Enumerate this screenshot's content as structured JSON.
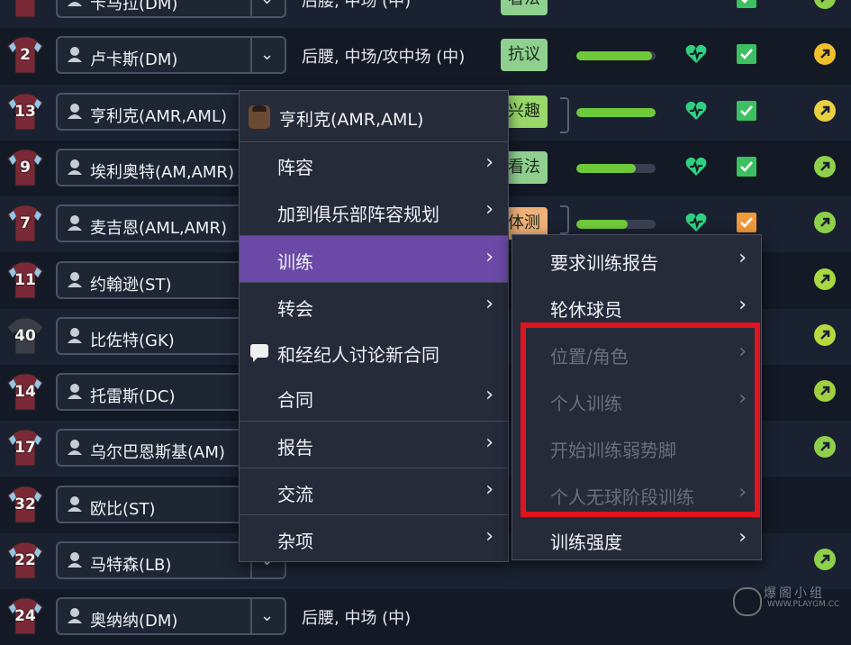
{
  "rows": [
    {
      "number": "",
      "name": "卡马拉(DM)",
      "position": "后腰, 中场 (中)",
      "tag": "看法",
      "tag_color": "#8fd08f",
      "fill": 0,
      "check": "green",
      "status": "#8fd04a"
    },
    {
      "number": "2",
      "name": "卢卡斯(DM)",
      "position": "后腰, 中场/攻中场 (中)",
      "tag": "抗议",
      "tag_color": "#8fd08f",
      "fill": 0.95,
      "check": "green",
      "status": "#f0c02a"
    },
    {
      "number": "13",
      "name": "亨利克(AMR,AML)",
      "position": "",
      "tag": "兴趣",
      "tag_color": "#9ad86a",
      "fill": 1.0,
      "check": "green",
      "status": "#e8d040"
    },
    {
      "number": "9",
      "name": "埃利奥特(AM,AMR)",
      "position": "",
      "tag": "看法",
      "tag_color": "#8fd08f",
      "fill": 0.75,
      "check": "green",
      "status": "#8fd04a"
    },
    {
      "number": "7",
      "name": "麦吉恩(AML,AMR)",
      "position": "",
      "tag": "体测",
      "tag_color": "#f0b07a",
      "fill": 0.65,
      "check": "orange",
      "status": "#8fd04a"
    },
    {
      "number": "11",
      "name": "约翰逊(ST)",
      "position": "",
      "tag": "",
      "tag_color": "",
      "fill": 0,
      "check": "none",
      "status": "#a8d840"
    },
    {
      "number": "40",
      "name": "比佐特(GK)",
      "position": "",
      "tag": "",
      "tag_color": "",
      "fill": 0,
      "check": "none",
      "status": "#b8d840"
    },
    {
      "number": "14",
      "name": "托雷斯(DC)",
      "position": "",
      "tag": "",
      "tag_color": "",
      "fill": 0,
      "check": "none",
      "status": "#9fd040"
    },
    {
      "number": "17",
      "name": "乌尔巴恩斯基(AM)",
      "position": "",
      "tag": "",
      "tag_color": "",
      "fill": 0,
      "check": "none",
      "status": "#8fd04a"
    },
    {
      "number": "32",
      "name": "欧比(ST)",
      "position": "",
      "tag": "",
      "tag_color": "",
      "fill": 0,
      "check": "none",
      "status": ""
    },
    {
      "number": "22",
      "name": "马特森(LB)",
      "position": "",
      "tag": "",
      "tag_color": "",
      "fill": 0,
      "check": "none",
      "status": "#8fd04a"
    },
    {
      "number": "24",
      "name": "奥纳纳(DM)",
      "position": "后腰, 中场 (中)",
      "tag": "",
      "tag_color": "",
      "fill": 0,
      "check": "none",
      "status": ""
    }
  ],
  "context_menu": {
    "header": "亨利克(AMR,AML)",
    "items": [
      {
        "label": "阵容",
        "arrow": "›"
      },
      {
        "label": "加到俱乐部阵容规划",
        "arrow": "›"
      },
      {
        "label": "训练",
        "arrow": "›"
      },
      {
        "label": "转会",
        "arrow": "›"
      },
      {
        "label": "和经纪人讨论新合同",
        "arrow": ""
      },
      {
        "label": "合同",
        "arrow": "›"
      },
      {
        "label": "报告",
        "arrow": "›"
      },
      {
        "label": "交流",
        "arrow": "›"
      },
      {
        "label": "杂项",
        "arrow": "›"
      }
    ]
  },
  "training_submenu": {
    "items": [
      {
        "label": "要求训练报告",
        "arrow": "›",
        "enabled": true
      },
      {
        "label": "轮休球员",
        "arrow": "›",
        "enabled": true
      },
      {
        "label": "位置/角色",
        "arrow": "›",
        "enabled": false
      },
      {
        "label": "个人训练",
        "arrow": "›",
        "enabled": false
      },
      {
        "label": "开始训练弱势脚",
        "arrow": "",
        "enabled": false
      },
      {
        "label": "个人无球阶段训练",
        "arrow": "›",
        "enabled": false
      },
      {
        "label": "训练强度",
        "arrow": "›",
        "enabled": true
      }
    ]
  },
  "watermark": {
    "line1": "爆阁小组",
    "line2": "WWW.PLAYGM.CC"
  },
  "colors": {
    "highlight": "#6a4aa6",
    "annotation_box": "#e0141e",
    "jersey": "#7a2a36"
  }
}
